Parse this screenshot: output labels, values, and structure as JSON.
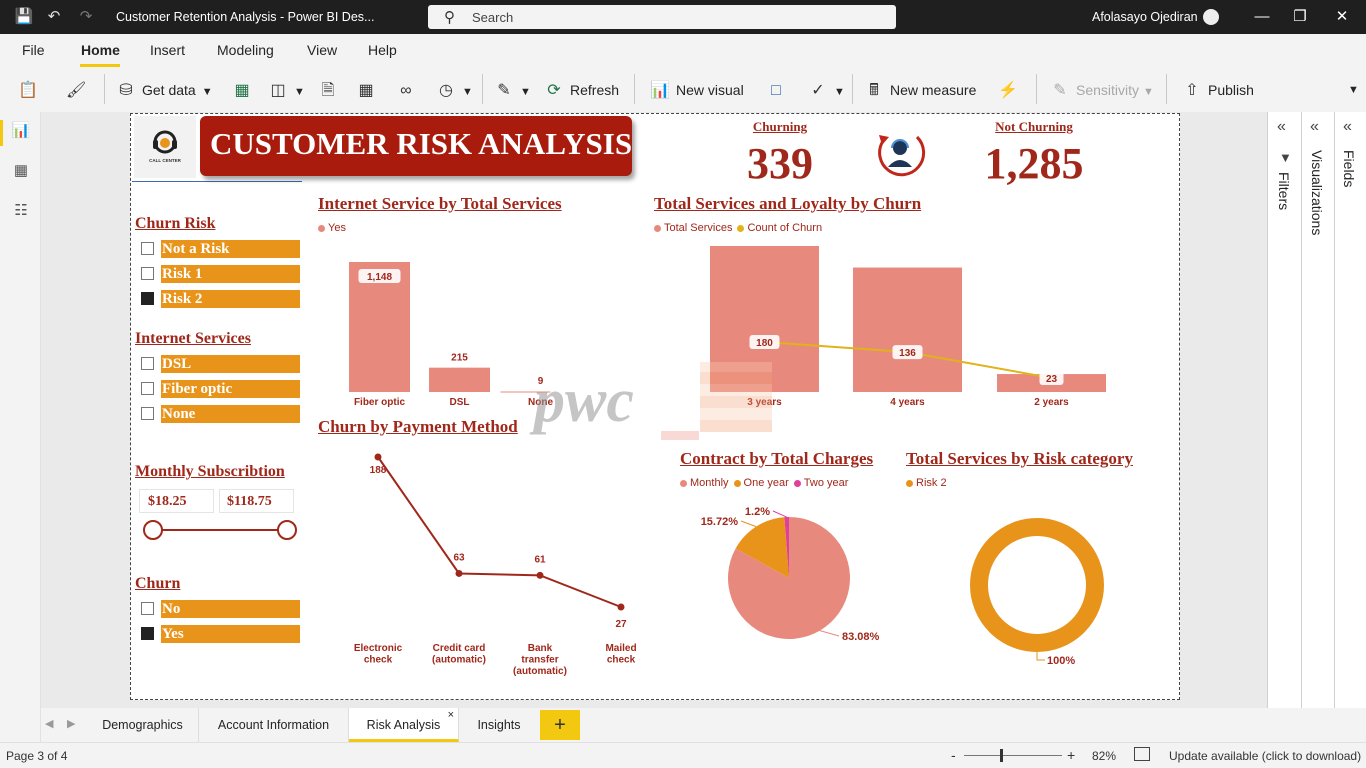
{
  "window": {
    "title": "Customer Retention Analysis - Power BI Des...",
    "search_placeholder": "Search",
    "user": "Afolasayo Ojediran"
  },
  "menu": {
    "items": [
      "File",
      "Home",
      "Insert",
      "Modeling",
      "View",
      "Help"
    ],
    "active": "Home"
  },
  "ribbon": {
    "get_data": "Get data",
    "refresh": "Refresh",
    "new_visual": "New visual",
    "new_measure": "New measure",
    "sensitivity": "Sensitivity",
    "publish": "Publish"
  },
  "report": {
    "main_title": "CUSTOMER RISK ANALYSIS",
    "logo_text": "CALL CENTER",
    "kpi_churning_label": "Churning",
    "kpi_churning_value": "339",
    "kpi_not_churning_label": "Not Churning",
    "kpi_not_churning_value": "1,285",
    "slicers": {
      "churn_risk": {
        "title": "Churn Risk",
        "items": [
          {
            "label": "Not a Risk",
            "checked": false
          },
          {
            "label": "Risk 1",
            "checked": false
          },
          {
            "label": "Risk 2",
            "checked": true
          }
        ]
      },
      "internet_services": {
        "title": "Internet Services",
        "items": [
          {
            "label": "DSL",
            "checked": false
          },
          {
            "label": "Fiber optic",
            "checked": false
          },
          {
            "label": "None",
            "checked": false
          }
        ]
      },
      "monthly": {
        "title": "Monthly Subscribtion",
        "min": "$18.25",
        "max": "$118.75"
      },
      "churn": {
        "title": "Churn",
        "items": [
          {
            "label": "No",
            "checked": false
          },
          {
            "label": "Yes",
            "checked": true
          }
        ]
      }
    },
    "watermark": "pwc"
  },
  "chart_data": [
    {
      "id": "internet-service",
      "type": "bar",
      "title": "Internet Service by Total Services",
      "legend": [
        "Yes"
      ],
      "categories": [
        "Fiber optic",
        "DSL",
        "None"
      ],
      "values": [
        1148,
        215,
        9
      ],
      "value_labels": [
        "1,148",
        "215",
        "9"
      ],
      "color": "#e8897e"
    },
    {
      "id": "services-loyalty",
      "type": "bar",
      "title": "Total Services and Loyalty by Churn",
      "legend": [
        "Total Services",
        "Count of Churn"
      ],
      "categories": [
        "3 years",
        "4 years",
        "2 years"
      ],
      "series": [
        {
          "name": "Total Services",
          "type": "bar",
          "values": [
            1220,
            1040,
            150
          ],
          "color": "#e8897e"
        },
        {
          "name": "Count of Churn",
          "type": "line",
          "values": [
            180,
            136,
            23
          ],
          "color": "#e2b21a"
        }
      ]
    },
    {
      "id": "payment-method",
      "type": "line",
      "title": "Churn by Payment Method",
      "categories": [
        "Electronic check",
        "Credit card (automatic)",
        "Bank transfer (automatic)",
        "Mailed check"
      ],
      "values": [
        188,
        63,
        61,
        27
      ],
      "color": "#a0281b"
    },
    {
      "id": "contract-charges",
      "type": "pie",
      "title": "Contract by Total Charges",
      "legend": [
        "Monthly",
        "One year",
        "Two year"
      ],
      "values": [
        83.08,
        15.72,
        1.2
      ],
      "value_labels": [
        "83.08%",
        "15.72%",
        "1.2%"
      ],
      "colors": [
        "#e8897e",
        "#e8941a",
        "#e0409a"
      ]
    },
    {
      "id": "risk-category",
      "type": "pie",
      "title": "Total Services by Risk category",
      "legend": [
        "Risk 2"
      ],
      "values": [
        100
      ],
      "value_labels": [
        "100%"
      ],
      "colors": [
        "#e8941a"
      ]
    }
  ],
  "tabs": [
    "Demographics",
    "Account Information",
    "Risk Analysis",
    "Insights"
  ],
  "active_tab": "Risk Analysis",
  "status": {
    "page": "Page 3 of 4",
    "zoom": "82%",
    "update": "Update available (click to download)"
  },
  "panes": {
    "filters": "Filters",
    "visualizations": "Visualizations",
    "fields": "Fields"
  }
}
